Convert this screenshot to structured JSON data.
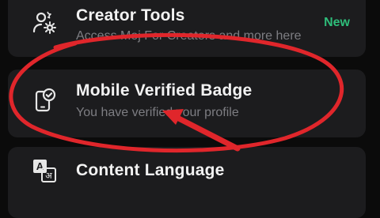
{
  "items": [
    {
      "title": "Creator Tools",
      "subtitle": "Access Moj For Creators and more here",
      "badge": "New",
      "icon": "creator-tools-icon"
    },
    {
      "title": "Mobile Verified Badge",
      "subtitle": "You have verified your profile",
      "icon": "phone-check-icon"
    },
    {
      "title": "Content Language",
      "icon": "translate-icon",
      "icon_glyphs": [
        "A",
        "अ"
      ]
    }
  ],
  "colors": {
    "background": "#0b0b0b",
    "card": "#1c1c1e",
    "badge_new": "#2ebd7a",
    "annotation": "#e0262b"
  }
}
